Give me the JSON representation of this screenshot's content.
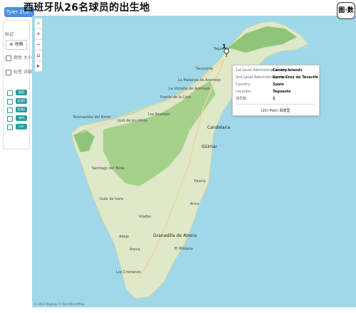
{
  "title": "西班牙队26名球员的出生地",
  "tab_label": "Tyler 202..",
  "sidebar": {
    "section_label": "标记",
    "marks_dropdown": "⊕ 地图",
    "row1": "颜色  大小",
    "row2": "标签  详细",
    "pills": [
      "国家",
      "区域1",
      "区域2",
      "城市",
      "Lon"
    ]
  },
  "logo_text": "图·数",
  "tooltip": {
    "rows": [
      {
        "label": "1st Level Administrative Areas:",
        "value": "Canary Islands"
      },
      {
        "label": "2nd Level Administrative Areas:",
        "value": "Santa Cruz de Tenerife"
      },
      {
        "label": "Country:",
        "value": "Spain"
      },
      {
        "label": "Location:",
        "value": "Tegueste"
      },
      {
        "label": "球员数:",
        "value": "1"
      }
    ],
    "player": "(20) Pedri 佩德里"
  },
  "marker_count": "1",
  "places": [
    {
      "name": "Tegueste"
    },
    {
      "name": "Tacoronte"
    },
    {
      "name": "La Matanza de Acentejo"
    },
    {
      "name": "La Victoria de Acentejo"
    },
    {
      "name": "Puerto de la Cruz"
    },
    {
      "name": "Los Realejos"
    },
    {
      "name": "Icod de los Vinos"
    },
    {
      "name": "Buenavista del Norte"
    },
    {
      "name": "Candelaria"
    },
    {
      "name": "Güímar"
    },
    {
      "name": "Santiago del Teide"
    },
    {
      "name": "Guía de Isora"
    },
    {
      "name": "Adeje"
    },
    {
      "name": "Arona"
    },
    {
      "name": "Granadilla de Abona"
    },
    {
      "name": "Los Cristianos"
    },
    {
      "name": "Vilaflor"
    },
    {
      "name": "Fasnia"
    },
    {
      "name": "Arico"
    },
    {
      "name": "El Médano"
    }
  ],
  "attribution": "© 2023 Mapbox © OpenStreetMap",
  "colors": {
    "sea": "#9fd8e8",
    "land": "#dfe8c8",
    "forest": "#9fce86",
    "pill": "#2c9c9c",
    "accent": "#4a90d9"
  }
}
